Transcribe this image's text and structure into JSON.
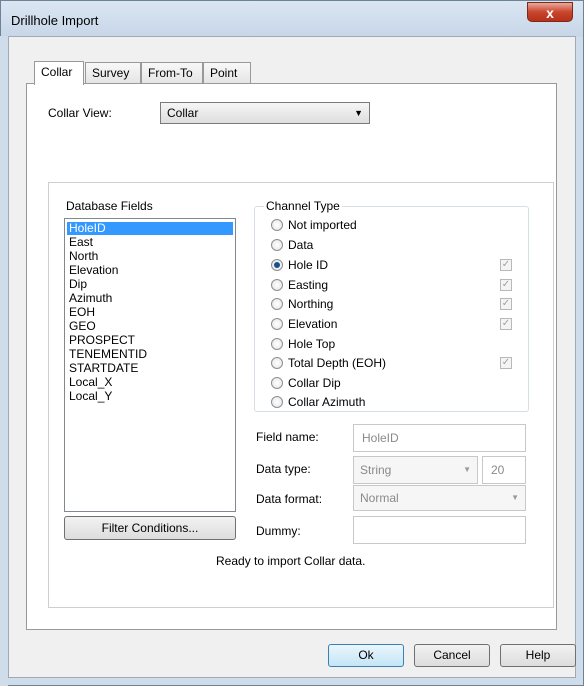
{
  "window": {
    "title": "Drillhole Import",
    "close_glyph": "x"
  },
  "tabs": [
    {
      "label": "Collar",
      "active": true
    },
    {
      "label": "Survey",
      "active": false
    },
    {
      "label": "From-To",
      "active": false
    },
    {
      "label": "Point",
      "active": false
    }
  ],
  "collar_view": {
    "label": "Collar View:",
    "value": "Collar"
  },
  "database_fields": {
    "label": "Database Fields",
    "items": [
      "HoleID",
      "East",
      "North",
      "Elevation",
      "Dip",
      "Azimuth",
      "EOH",
      "GEO",
      "PROSPECT",
      "TENEMENTID",
      "STARTDATE",
      "Local_X",
      "Local_Y"
    ],
    "selected": "HoleID"
  },
  "filter_button": "Filter Conditions...",
  "channel_type": {
    "label": "Channel Type",
    "options": [
      {
        "label": "Not imported",
        "selected": false,
        "has_check": false
      },
      {
        "label": "Data",
        "selected": false,
        "has_check": false
      },
      {
        "label": "Hole ID",
        "selected": true,
        "has_check": true
      },
      {
        "label": "Easting",
        "selected": false,
        "has_check": true
      },
      {
        "label": "Northing",
        "selected": false,
        "has_check": true
      },
      {
        "label": "Elevation",
        "selected": false,
        "has_check": true
      },
      {
        "label": "Hole Top",
        "selected": false,
        "has_check": false
      },
      {
        "label": "Total Depth (EOH)",
        "selected": false,
        "has_check": true
      },
      {
        "label": "Collar Dip",
        "selected": false,
        "has_check": false
      },
      {
        "label": "Collar Azimuth",
        "selected": false,
        "has_check": false
      }
    ]
  },
  "field_name": {
    "label": "Field name:",
    "value": "HoleID"
  },
  "data_type": {
    "label": "Data type:",
    "value": "String",
    "width": "20"
  },
  "data_format": {
    "label": "Data format:",
    "value": "Normal"
  },
  "dummy": {
    "label": "Dummy:",
    "value": ""
  },
  "status": "Ready to import Collar data.",
  "buttons": {
    "ok": "Ok",
    "cancel": "Cancel",
    "help": "Help"
  }
}
